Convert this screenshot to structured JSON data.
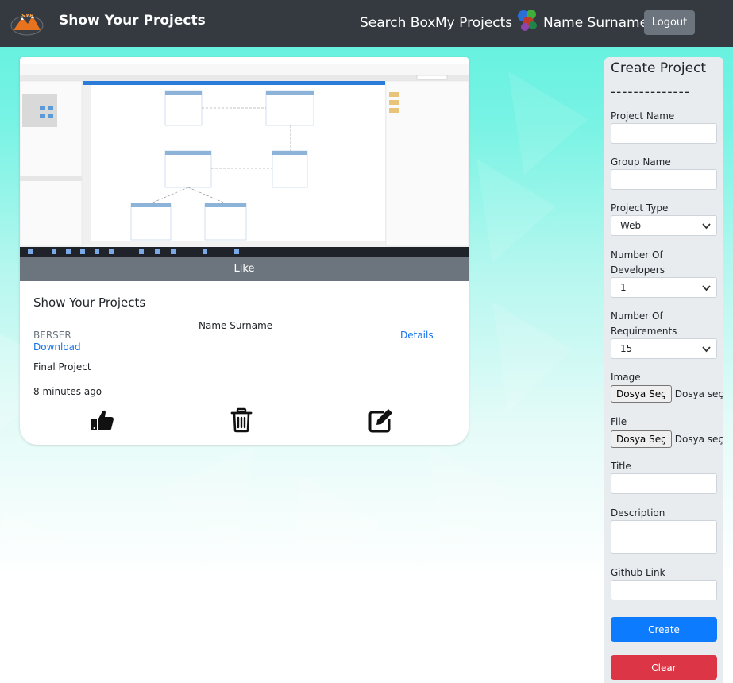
{
  "navbar": {
    "brand": "Show Your Projects",
    "logo_icon": "syp-mountain-logo",
    "links": [
      "Search Box",
      "My Projects"
    ],
    "user_name": "Name Surname",
    "avatar_icon": "colorful-avatar-icon",
    "logout_label": "Logout"
  },
  "card": {
    "like_label": "Like",
    "title": "Show Your Projects",
    "author": "Name Surname",
    "group": "BERSER",
    "download_label": "Download",
    "details_label": "Details",
    "project_type": "Final Project",
    "time_ago": "8 minutes ago",
    "actions": {
      "like_icon": "thumbs-up-icon",
      "delete_icon": "trash-icon",
      "edit_icon": "edit-icon"
    }
  },
  "form": {
    "title": "Create Project",
    "divider": "--------------",
    "project_name_label": "Project Name",
    "group_name_label": "Group Name",
    "project_type_label": "Project Type",
    "project_type_value": "Web",
    "num_developers_label": "Number Of Developers",
    "num_developers_value": "1",
    "num_requirements_label": "Number Of Requirements",
    "num_requirements_value": "15",
    "image_label": "Image",
    "file_label": "File",
    "choose_file_label": "Dosya Seç",
    "no_file_text": "Dosya seçilmedi",
    "title_label": "Title",
    "description_label": "Description",
    "github_label": "Github Link",
    "create_label": "Create",
    "clear_label": "Clear"
  },
  "colors": {
    "navbar": "#343a40",
    "primary": "#0d7bfe",
    "danger": "#dc3545",
    "secondary": "#6c757d",
    "link": "#1a73e8",
    "background": "#5ef0de"
  }
}
